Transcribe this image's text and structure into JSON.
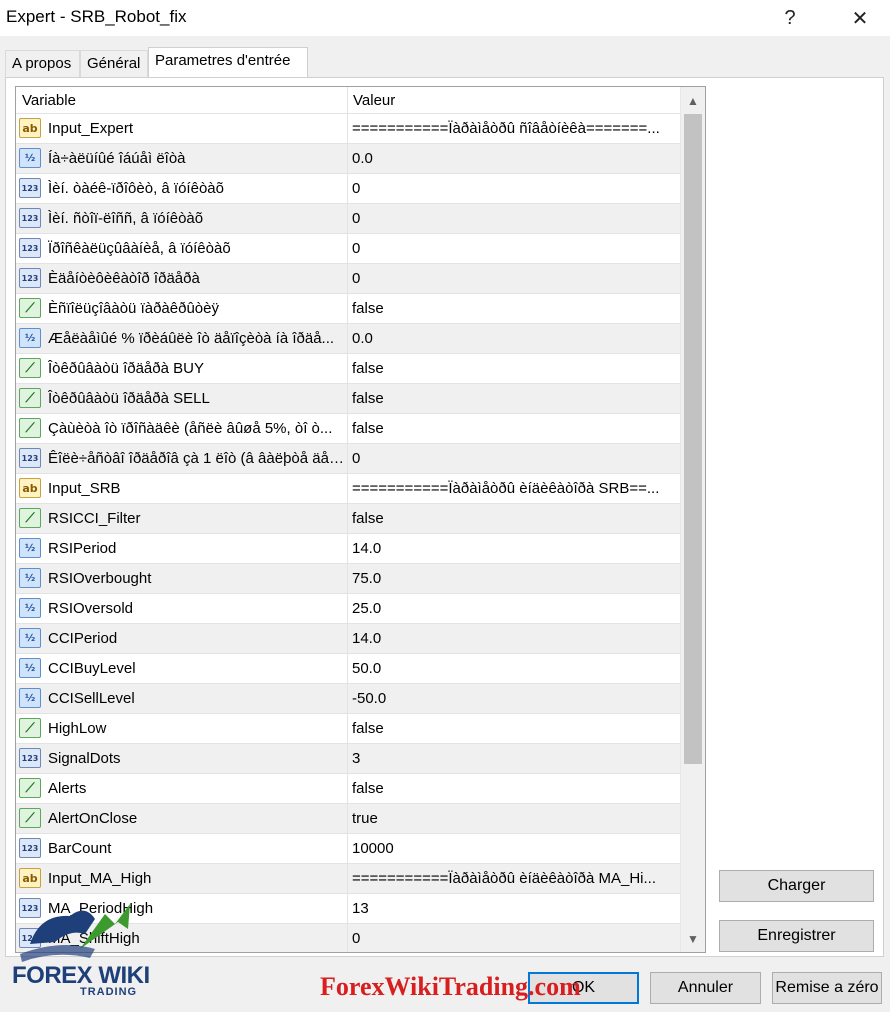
{
  "window": {
    "title": "Expert - SRB_Robot_fix",
    "help_glyph": "?",
    "close_glyph": "✕"
  },
  "tabs": [
    {
      "label": "A propos",
      "active": false
    },
    {
      "label": "Général",
      "active": false
    },
    {
      "label": "Parametres d'entrée",
      "active": true
    }
  ],
  "grid": {
    "columns": {
      "variable": "Variable",
      "value": "Valeur"
    },
    "rows": [
      {
        "type": "ab",
        "icon": "ab",
        "name": "Input_Expert",
        "value": "===========Ïàðàìåòðû ñîâåòíèêà=======..."
      },
      {
        "type": "half",
        "icon": "½",
        "name": "Íà÷àëüíûé îáúåì ëîòà",
        "value": "0.0"
      },
      {
        "type": "int",
        "icon": "123",
        "name": "Ìèí. òàéê-ïðîôèò, â ïóíêòàõ",
        "value": "0"
      },
      {
        "type": "int",
        "icon": "123",
        "name": "Ìèí. ñòîï-ëîññ, â ïóíêòàõ",
        "value": "0"
      },
      {
        "type": "int",
        "icon": "123",
        "name": "Ïðîñêàëüçûâàíèå, â ïóíêòàõ",
        "value": "0"
      },
      {
        "type": "int",
        "icon": "123",
        "name": "Èäåíòèôèêàòîð îðäåðà",
        "value": "0"
      },
      {
        "type": "bool",
        "icon": "⟋",
        "name": "Èñïîëüçîâàòü ïàðàêðûòèÿ",
        "value": "false"
      },
      {
        "type": "half",
        "icon": "½",
        "name": "Æåëàåìûé % ïðèáûëè îò äåïîçèòà íà îðäå...",
        "value": "0.0"
      },
      {
        "type": "bool",
        "icon": "⟋",
        "name": "Îòêðûâàòü îðäåðà BUY",
        "value": "false"
      },
      {
        "type": "bool",
        "icon": "⟋",
        "name": "Îòêðûâàòü îðäåðà SELL",
        "value": "false"
      },
      {
        "type": "bool",
        "icon": "⟋",
        "name": "Çàùèòà îò ïðîñàäêè (åñëè âûøå 5%, òî ò...",
        "value": "false"
      },
      {
        "type": "int",
        "icon": "123",
        "name": "Êîëè÷åñòâî îðäåðîâ çà 1 ëîò (â âàëþòå äåï...",
        "value": "0"
      },
      {
        "type": "ab",
        "icon": "ab",
        "name": "Input_SRB",
        "value": "===========Ïàðàìåòðû èíäèêàòîðà SRB==..."
      },
      {
        "type": "bool",
        "icon": "⟋",
        "name": "RSICCI_Filter",
        "value": "false"
      },
      {
        "type": "half",
        "icon": "½",
        "name": "RSIPeriod",
        "value": "14.0"
      },
      {
        "type": "half",
        "icon": "½",
        "name": "RSIOverbought",
        "value": "75.0"
      },
      {
        "type": "half",
        "icon": "½",
        "name": "RSIOversold",
        "value": "25.0"
      },
      {
        "type": "half",
        "icon": "½",
        "name": "CCIPeriod",
        "value": "14.0"
      },
      {
        "type": "half",
        "icon": "½",
        "name": "CCIBuyLevel",
        "value": "50.0"
      },
      {
        "type": "half",
        "icon": "½",
        "name": "CCISellLevel",
        "value": "-50.0"
      },
      {
        "type": "bool",
        "icon": "⟋",
        "name": "HighLow",
        "value": "false"
      },
      {
        "type": "int",
        "icon": "123",
        "name": "SignalDots",
        "value": "3"
      },
      {
        "type": "bool",
        "icon": "⟋",
        "name": "Alerts",
        "value": "false"
      },
      {
        "type": "bool",
        "icon": "⟋",
        "name": "AlertOnClose",
        "value": "true"
      },
      {
        "type": "int",
        "icon": "123",
        "name": "BarCount",
        "value": "10000"
      },
      {
        "type": "ab",
        "icon": "ab",
        "name": "Input_MA_High",
        "value": "===========Ïàðàìåòðû èíäèêàòîðà MA_Hi..."
      },
      {
        "type": "int",
        "icon": "123",
        "name": "MA_PeriodHigh",
        "value": "13"
      },
      {
        "type": "int",
        "icon": "123",
        "name": "MA_ShiftHigh",
        "value": "0"
      }
    ]
  },
  "buttons": {
    "load": "Charger",
    "save": "Enregistrer",
    "ok": "OK",
    "cancel": "Annuler",
    "reset": "Remise a zéro"
  },
  "branding": {
    "logo_text": "FOREX WIKI",
    "logo_sub": "TRADING",
    "watermark": "ForexWikiTrading.com"
  }
}
